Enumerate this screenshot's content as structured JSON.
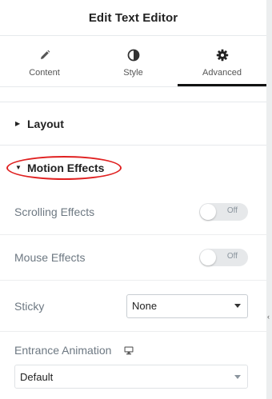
{
  "header": {
    "title": "Edit Text Editor"
  },
  "tabs": [
    {
      "label": "Content",
      "icon": "pencil-icon",
      "active": false
    },
    {
      "label": "Style",
      "icon": "half-circle-icon",
      "active": false
    },
    {
      "label": "Advanced",
      "icon": "gear-icon",
      "active": true
    }
  ],
  "sections": {
    "layout": {
      "title": "Layout",
      "expanded": false
    },
    "motion_effects": {
      "title": "Motion Effects",
      "expanded": true
    }
  },
  "controls": {
    "scrolling_effects": {
      "label": "Scrolling Effects",
      "state": "Off"
    },
    "mouse_effects": {
      "label": "Mouse Effects",
      "state": "Off"
    },
    "sticky": {
      "label": "Sticky",
      "value": "None"
    },
    "entrance_animation": {
      "label": "Entrance Animation",
      "value": "Default",
      "device_icon": "desktop-monitor-icon"
    }
  },
  "colors": {
    "annotation": "#e02020",
    "accent": "#111111"
  }
}
